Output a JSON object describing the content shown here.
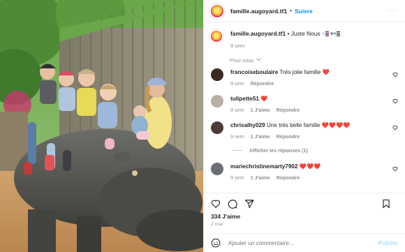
{
  "post": {
    "author": "famille.augoyard.tf1",
    "follow_label": "Suivre",
    "caption": "Juste Nous",
    "caption_time": "9 sem",
    "see_translation": "Pour vous"
  },
  "comments": [
    {
      "user": "francoiseboulaire",
      "text": "Très jolie famille ❤️",
      "time": "9 sem",
      "likes": "",
      "reply": "Répondre",
      "show_replies": "",
      "avatar_color": "#3a2a22"
    },
    {
      "user": "tulipette51",
      "text": "❤️",
      "time": "9 sem",
      "likes": "1 J'aime",
      "reply": "Répondre",
      "show_replies": "",
      "avatar_color": "#b8b0a4"
    },
    {
      "user": "chrisalhy029",
      "text": "Une très belle famille ❤️❤️❤️❤️",
      "time": "9 sem",
      "likes": "1 J'aime",
      "reply": "Répondre",
      "show_replies": "Afficher les réponses (1)",
      "avatar_color": "#4a3b36"
    },
    {
      "user": "mariechristinemarty7902",
      "text": "❤️❤️❤️",
      "time": "9 sem",
      "likes": "1 J'aime",
      "reply": "Répondre",
      "show_replies": "",
      "avatar_color": "#6b6e74"
    }
  ],
  "actions": {
    "likes_count": "334 J'aime",
    "date": "2 mai"
  },
  "composer": {
    "placeholder": "Ajouter un commentaire...",
    "publish_label": "Publier"
  },
  "colors": {
    "link_blue": "#0095f6",
    "muted": "#8e8e8e",
    "heart_red": "#ed4956",
    "publish_disabled": "#b2dffc"
  }
}
